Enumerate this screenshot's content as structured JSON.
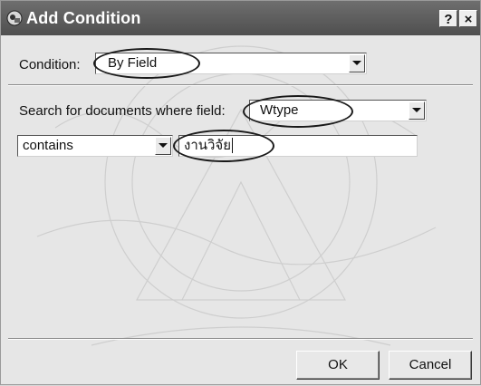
{
  "dialog": {
    "title": "Add Condition",
    "help_glyph": "?",
    "close_glyph": "×"
  },
  "condition": {
    "label": "Condition:",
    "value": "By Field"
  },
  "search": {
    "label": "Search for documents where field:",
    "field_value": "Wtype",
    "operator_value": "contains",
    "text_value": "งานวิจัย"
  },
  "buttons": {
    "ok": "OK",
    "cancel": "Cancel"
  },
  "icons": [
    "app-icon",
    "help-icon",
    "close-icon",
    "dropdown-arrow-icon"
  ],
  "colors": {
    "titlebar": "#5a5a5a",
    "dialog_bg": "#e6e6e6",
    "field_bg": "#ffffff"
  }
}
